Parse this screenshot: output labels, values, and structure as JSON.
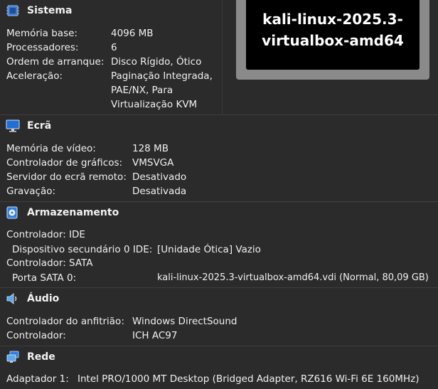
{
  "system": {
    "title": "Sistema",
    "icon": "chip-icon",
    "rows": [
      {
        "label": "Memória base:",
        "value": "4096 MB"
      },
      {
        "label": "Processadores:",
        "value": "6"
      },
      {
        "label": "Ordem de arranque:",
        "value": "Disco Rígido, Ótico"
      },
      {
        "label": "Aceleração:",
        "value": "Paginação Integrada, PAE/NX, Para Virtualização KVM"
      }
    ]
  },
  "preview": {
    "line1": "kali-linux-2025.3-",
    "line2": "virtualbox-amd64"
  },
  "display": {
    "title": "Ecrã",
    "icon": "monitor-icon",
    "rows": [
      {
        "label": "Memória de vídeo:",
        "value": "128 MB"
      },
      {
        "label": "Controlador de gráficos:",
        "value": "VMSVGA"
      },
      {
        "label": "Servidor do ecrã remoto:",
        "value": "Desativado"
      },
      {
        "label": "Gravação:",
        "value": "Desativada"
      }
    ]
  },
  "storage": {
    "title": "Armazenamento",
    "icon": "storage-disk-icon",
    "controller_ide": "Controlador: IDE",
    "ide_device_label": "Dispositivo secundário 0 IDE:",
    "ide_device_value": "[Unidade Ótica] Vazio",
    "controller_sata": "Controlador: SATA",
    "sata_port_label": "Porta SATA 0:",
    "sata_port_value": "kali-linux-2025.3-virtualbox-amd64.vdi (Normal, 80,09 GB)"
  },
  "audio": {
    "title": "Áudio",
    "icon": "speaker-icon",
    "rows": [
      {
        "label": "Controlador do anfitrião:",
        "value": "Windows DirectSound"
      },
      {
        "label": "Controlador:",
        "value": "ICH AC97"
      }
    ]
  },
  "network": {
    "title": "Rede",
    "icon": "network-icon",
    "adapter_label": "Adaptador 1:",
    "adapter_value": "Intel PRO/1000 MT Desktop (Bridged Adapter, RZ616 Wi-Fi 6E 160MHz)"
  }
}
